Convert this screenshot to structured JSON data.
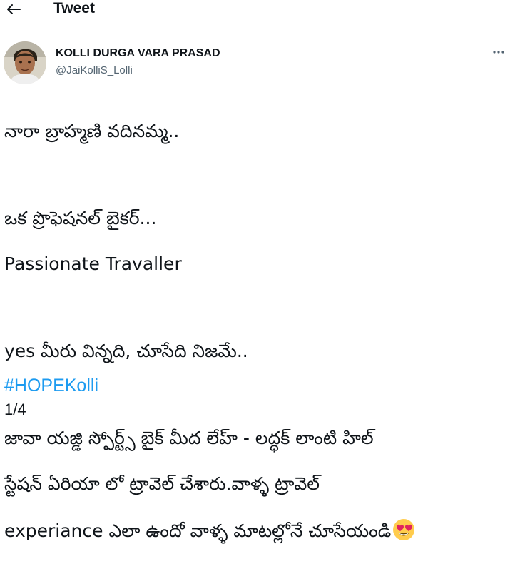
{
  "header": {
    "title": "Tweet",
    "back_icon": "arrow-left-icon"
  },
  "author": {
    "display_name": "KOLLI DURGA VARA PRASAD",
    "handle": "@JaiKolliS_Lolli",
    "more_icon": "more-horizontal-icon"
  },
  "tweet": {
    "lines": [
      "నారా బ్రాహ్మణి వదినమ్మ..",
      "ఒక ప్రొఫెషనల్ బైకర్...",
      "Passionate Travaller",
      "  yes మీరు విన్నది, చూసేది నిజమే..",
      "జావా యజ్డి స్పోర్ట్స్ బైక్ మీద లేహ్ - లద్ధక్ లాంటి హిల్",
      "స్టేషన్ ఏరియా లో  ట్రావెల్ చేశారు.వాళ్ళ ట్రావెల్",
      "experiance ఎలా ఉందో వాళ్ళ మాటల్లోనే చూసేయండి"
    ],
    "emoji_icon": "heart-eyes-emoji-icon",
    "hashtag": "#HOPEKolli",
    "counter": "1/4"
  },
  "colors": {
    "text": "#0f1419",
    "secondary": "#536471",
    "link": "#1d9bf0"
  }
}
